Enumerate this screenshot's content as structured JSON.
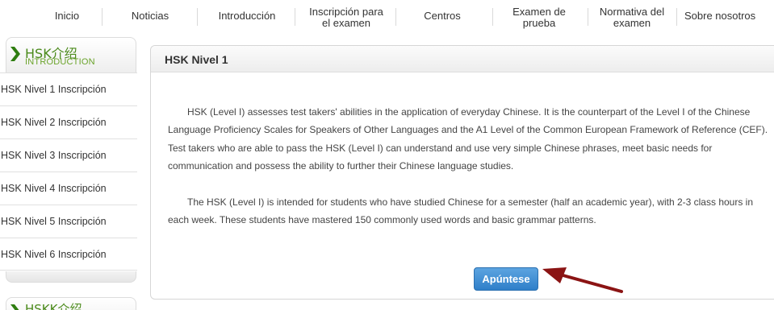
{
  "nav": {
    "items": [
      {
        "label": "Inicio"
      },
      {
        "label": "Noticias"
      },
      {
        "label": "Introducción"
      },
      {
        "label": "Inscripción para el examen"
      },
      {
        "label": "Centros"
      },
      {
        "label": "Examen de prueba"
      },
      {
        "label": "Normativa del examen"
      },
      {
        "label": "Sobre nosotros"
      }
    ]
  },
  "sidebar": {
    "section1": {
      "title_zh": "HSK介绍",
      "title_en": "INTRODUCTION"
    },
    "items": [
      {
        "label": "HSK Nivel 1 Inscripción"
      },
      {
        "label": "HSK Nivel 2 Inscripción"
      },
      {
        "label": "HSK Nivel 3 Inscripción"
      },
      {
        "label": "HSK Nivel 4 Inscripción"
      },
      {
        "label": "HSK Nivel 5 Inscripción"
      },
      {
        "label": "HSK Nivel 6 Inscripción"
      }
    ],
    "section2": {
      "title_zh": "HSKK介绍"
    }
  },
  "main": {
    "title": "HSK Nivel 1",
    "paragraphs": [
      "HSK (Level I) assesses test takers' abilities in the application of everyday Chinese. It is the counterpart of the Level I of the Chinese Language Proficiency Scales for Speakers of Other Languages and the A1 Level of the Common European Framework of Reference (CEF). Test takers who are able to pass the HSK (Level I) can understand and use very simple Chinese phrases, meet basic needs for communication and possess the ability to further their Chinese language studies.",
      "The HSK (Level I) is intended for students who have studied Chinese for a semester (half an academic year), with 2-3 class hours in each week. These students have mastered 150 commonly used words and basic grammar patterns."
    ],
    "apply_label": "Apúntese"
  },
  "colors": {
    "accent_green": "#4a8a1a",
    "button_blue": "#3b88d0",
    "arrow_red": "#8b1414"
  }
}
